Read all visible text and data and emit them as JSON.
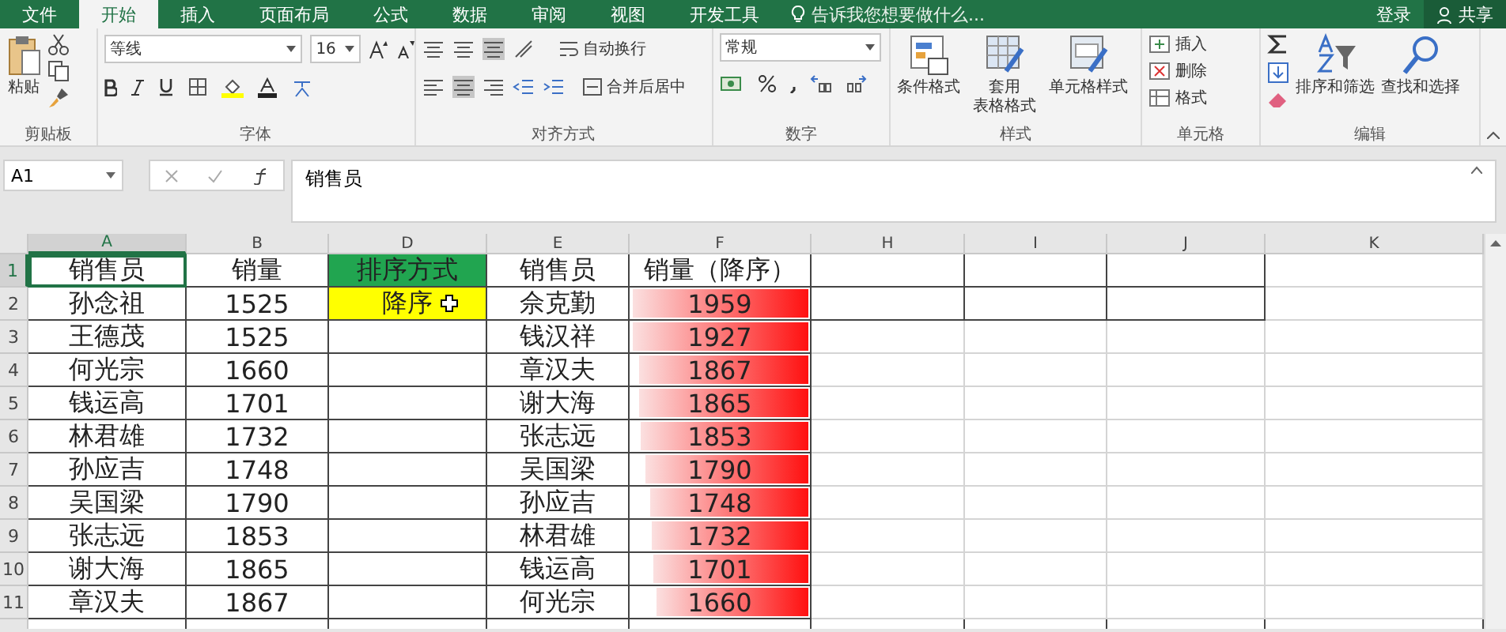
{
  "tabs": [
    {
      "label": "文件",
      "selected": false
    },
    {
      "label": "开始",
      "selected": true
    },
    {
      "label": "插入",
      "selected": false
    },
    {
      "label": "页面布局",
      "selected": false
    },
    {
      "label": "公式",
      "selected": false
    },
    {
      "label": "数据",
      "selected": false
    },
    {
      "label": "审阅",
      "selected": false
    },
    {
      "label": "视图",
      "selected": false
    },
    {
      "label": "开发工具",
      "selected": false
    }
  ],
  "tell_me": "告诉我您想要做什么...",
  "sign_in": "登录",
  "share": "共享",
  "ribbon": {
    "clipboard": {
      "paste": "粘贴",
      "label": "剪贴板"
    },
    "font": {
      "name": "等线",
      "size": "16",
      "label": "字体"
    },
    "alignment": {
      "wrap": "自动换行",
      "merge": "合并后居中",
      "label": "对齐方式"
    },
    "number": {
      "format": "常规",
      "label": "数字"
    },
    "styles": {
      "conditional": "条件格式",
      "table_line1": "套用",
      "table_line2": "表格格式",
      "cell_styles": "单元格样式",
      "label": "样式"
    },
    "cells": {
      "insert": "插入",
      "delete": "删除",
      "format": "格式",
      "label": "单元格"
    },
    "editing": {
      "sort": "排序和筛选",
      "find": "查找和选择",
      "label": "编辑"
    }
  },
  "formula_bar": {
    "name_box": "A1",
    "formula": "销售员"
  },
  "sheet": {
    "columns": [
      {
        "label": "A",
        "selected": true
      },
      {
        "label": "B",
        "selected": false
      },
      {
        "label": "D",
        "selected": false
      },
      {
        "label": "E",
        "selected": false
      },
      {
        "label": "F",
        "selected": false
      },
      {
        "label": "H",
        "selected": false
      },
      {
        "label": "I",
        "selected": false
      },
      {
        "label": "J",
        "selected": false
      },
      {
        "label": "K",
        "selected": false
      }
    ],
    "header_row": {
      "number": "1",
      "selected": true,
      "a": "销售员",
      "b": "销量",
      "d": {
        "text": "排序方式",
        "color": "#21a550"
      },
      "e": "销售员",
      "f": "销量（降序）"
    },
    "rows": [
      {
        "number": "2",
        "selected": false,
        "a": "孙念祖",
        "b": "1525",
        "d": {
          "text": "降序",
          "color": "#ffff00"
        },
        "e": "佘克勤",
        "f": "1959",
        "level": 1.0
      },
      {
        "number": "3",
        "selected": false,
        "a": "王德茂",
        "b": "1525",
        "e": "钱汉祥",
        "f": "1927",
        "level": 0.98
      },
      {
        "number": "4",
        "selected": false,
        "a": "何光宗",
        "b": "1660",
        "e": "章汉夫",
        "f": "1867",
        "level": 0.94
      },
      {
        "number": "5",
        "selected": false,
        "a": "钱运高",
        "b": "1701",
        "e": "谢大海",
        "f": "1865",
        "level": 0.94
      },
      {
        "number": "6",
        "selected": false,
        "a": "林君雄",
        "b": "1732",
        "e": "张志远",
        "f": "1853",
        "level": 0.93
      },
      {
        "number": "7",
        "selected": false,
        "a": "孙应吉",
        "b": "1748",
        "e": "吴国梁",
        "f": "1790",
        "level": 0.9
      },
      {
        "number": "8",
        "selected": false,
        "a": "吴国梁",
        "b": "1790",
        "e": "孙应吉",
        "f": "1748",
        "level": 0.88
      },
      {
        "number": "9",
        "selected": false,
        "a": "张志远",
        "b": "1853",
        "e": "林君雄",
        "f": "1732",
        "level": 0.87
      },
      {
        "number": "10",
        "selected": false,
        "a": "谢大海",
        "b": "1865",
        "e": "钱运高",
        "f": "1701",
        "level": 0.86
      },
      {
        "number": "11",
        "selected": false,
        "a": "章汉夫",
        "b": "1867",
        "e": "何光宗",
        "f": "1660",
        "level": 0.84
      }
    ]
  }
}
